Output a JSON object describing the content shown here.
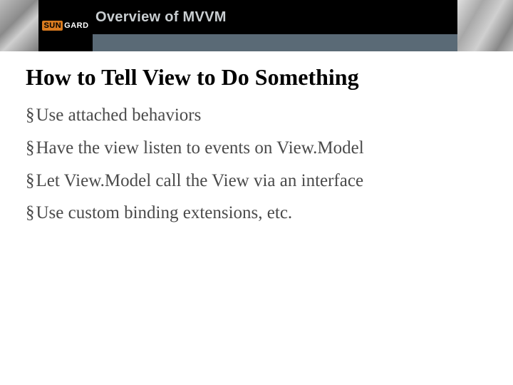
{
  "header": {
    "logo_text_a": "SUN",
    "logo_text_b": "GARD",
    "topic": "Overview of MVVM"
  },
  "slide": {
    "title": "How to Tell View to Do Something",
    "bullets": [
      "Use attached behaviors",
      "Have the view listen to events on View.Model",
      "Let View.Model call the View via an interface",
      "Use custom binding extensions, etc."
    ]
  }
}
